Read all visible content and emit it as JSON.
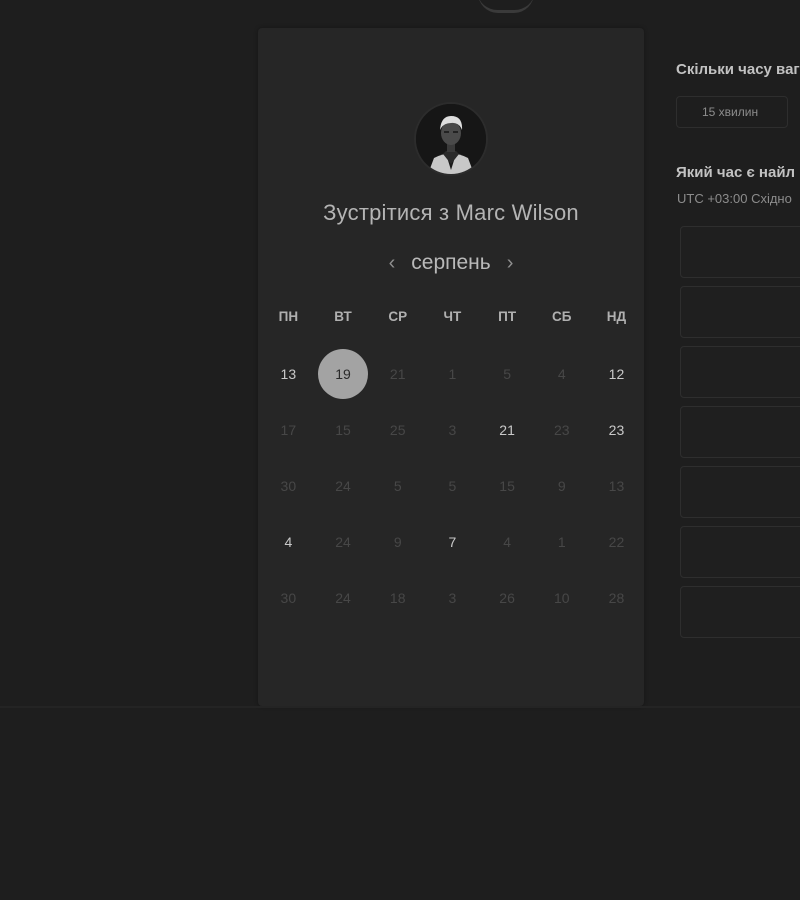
{
  "booking": {
    "title": "Зустрітися з Marc Wilson",
    "month": "серпень",
    "prev_icon": "‹",
    "next_icon": "›",
    "weekdays": [
      "ПН",
      "ВТ",
      "СР",
      "ЧТ",
      "ПТ",
      "СБ",
      "НД"
    ],
    "weeks": [
      [
        {
          "label": "13",
          "active": true
        },
        {
          "label": "19",
          "active": true,
          "selected": true
        },
        {
          "label": "21",
          "active": false
        },
        {
          "label": "1",
          "active": false
        },
        {
          "label": "5",
          "active": false
        },
        {
          "label": "4",
          "active": false
        },
        {
          "label": "12",
          "active": true
        }
      ],
      [
        {
          "label": "17",
          "active": false
        },
        {
          "label": "15",
          "active": false
        },
        {
          "label": "25",
          "active": false
        },
        {
          "label": "3",
          "active": false
        },
        {
          "label": "21",
          "active": true
        },
        {
          "label": "23",
          "active": false
        },
        {
          "label": "23",
          "active": true
        }
      ],
      [
        {
          "label": "30",
          "active": false
        },
        {
          "label": "24",
          "active": false
        },
        {
          "label": "5",
          "active": false
        },
        {
          "label": "5",
          "active": false
        },
        {
          "label": "15",
          "active": false
        },
        {
          "label": "9",
          "active": false
        },
        {
          "label": "13",
          "active": false
        }
      ],
      [
        {
          "label": "4",
          "active": true
        },
        {
          "label": "24",
          "active": false
        },
        {
          "label": "9",
          "active": false
        },
        {
          "label": "7",
          "active": true
        },
        {
          "label": "4",
          "active": false
        },
        {
          "label": "1",
          "active": false
        },
        {
          "label": "22",
          "active": false
        }
      ],
      [
        {
          "label": "30",
          "active": false
        },
        {
          "label": "24",
          "active": false
        },
        {
          "label": "18",
          "active": false
        },
        {
          "label": "3",
          "active": false
        },
        {
          "label": "26",
          "active": false
        },
        {
          "label": "10",
          "active": false
        },
        {
          "label": "28",
          "active": false
        }
      ]
    ]
  },
  "side": {
    "duration_heading": "Скільки часу ваг",
    "duration_value": "15 хвилин",
    "time_heading": "Який час є найл",
    "timezone": "UTC +03:00 Східно"
  },
  "time_slots": [
    "",
    "",
    "",
    "",
    "",
    "",
    ""
  ],
  "colors": {
    "background": "#1e1e1e",
    "card": "#262626",
    "selected_day": "#a3a3a3"
  }
}
